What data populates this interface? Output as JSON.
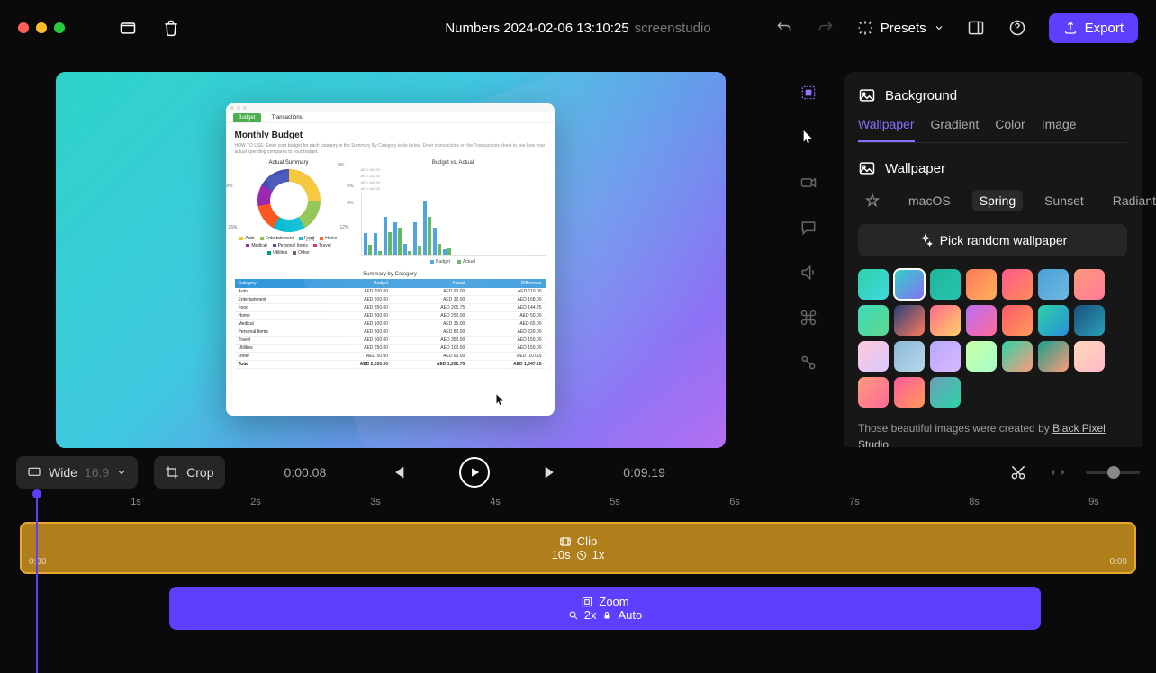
{
  "header": {
    "title": "Numbers 2024-02-06 13:10:25",
    "subtitle": "screenstudio",
    "presets_label": "Presets",
    "export_label": "Export"
  },
  "inspector": {
    "section_title": "Background",
    "tabs": [
      "Wallpaper",
      "Gradient",
      "Color",
      "Image"
    ],
    "sub_title": "Wallpaper",
    "categories": [
      "macOS",
      "Spring",
      "Sunset",
      "Radiant"
    ],
    "pick_label": "Pick random wallpaper",
    "thumbs": [
      "linear-gradient(135deg,#2dd3a8,#3fd8e0)",
      "linear-gradient(135deg,#2dd3c8,#8b6ff5)",
      "linear-gradient(135deg,#1fb59a,#28c4ae)",
      "linear-gradient(135deg,#ff7a5a,#ffb05a)",
      "linear-gradient(135deg,#ff5a8a,#ff8a5a)",
      "linear-gradient(135deg,#4a9fd8,#6fb8e0)",
      "linear-gradient(135deg,#ff9a7a,#ff7a9a)",
      "linear-gradient(135deg,#3dd8b8,#5fd890)",
      "linear-gradient(135deg,#2a3f7a,#ff7a5a)",
      "linear-gradient(135deg,#ff6a8a,#ffcf6a)",
      "linear-gradient(135deg,#b86ff5,#ff6a9a)",
      "linear-gradient(135deg,#ff5a6a,#ff9a5a)",
      "linear-gradient(135deg,#2dd3a8,#2a8fd8)",
      "linear-gradient(135deg,#1a4f7a,#2a9fb8)",
      "linear-gradient(135deg,#ffc8d8,#d8c8ff)",
      "linear-gradient(135deg,#8ab8d8,#b8d8e8)",
      "linear-gradient(135deg,#b8a8ff,#d8b8ff)",
      "linear-gradient(135deg,#c8ffa8,#a8ffc8)",
      "linear-gradient(135deg,#2dd3a8,#ff9a7a)",
      "linear-gradient(135deg,#1a9f8a,#ff9a7a)",
      "linear-gradient(135deg,#ffd8b8,#ffb8c8)",
      "linear-gradient(135deg,#ff9a7a,#ff6a9a)",
      "linear-gradient(135deg,#ff5a9a,#ff9a5a)",
      "linear-gradient(135deg,#6a9fb8,#2dd3a8)"
    ],
    "credit_prefix": "Those beautiful images were created by ",
    "credit_link": "Black Pixel Studio"
  },
  "transport": {
    "wide_label": "Wide",
    "wide_ratio": "16:9",
    "crop_label": "Crop",
    "tc_current": "0:00.08",
    "tc_total": "0:09.19"
  },
  "timeline": {
    "ticks": [
      "1s",
      "2s",
      "3s",
      "4s",
      "5s",
      "6s",
      "7s",
      "8s",
      "9s"
    ],
    "clip_label": "Clip",
    "clip_duration": "10s",
    "clip_speed": "1x",
    "clip_start": "0:00",
    "clip_end": "0:09",
    "zoom_label": "Zoom",
    "zoom_amount": "2x",
    "zoom_mode": "Auto"
  },
  "doc": {
    "tab_active": "Budget",
    "tab_other": "Transactions",
    "h1": "Monthly Budget",
    "howto": "HOW TO USE: Enter your budget for each category in the Summary By Category table below. Enter transactions on the Transactions sheet to see how your actual spending compares to your budget.",
    "donut_title": "Actual Summary",
    "donut_labels": [
      "28%",
      "8%",
      "5%",
      "3%",
      "12%",
      "17%",
      "25%"
    ],
    "donut_side": [
      "AED 100.00",
      "AED 100.00",
      "AED 100.00",
      "AED 100.00"
    ],
    "bars_title": "Budget vs. Actual",
    "legend_items": [
      "Auto",
      "Entertainment",
      "Food",
      "Home",
      "Medical",
      "Personal Items",
      "Travel",
      "Utilities",
      "Other"
    ],
    "bars_legend": [
      "Budget",
      "Actual"
    ],
    "table_title": "Summary by Category",
    "table_headers": [
      "Category",
      "Budget",
      "Actual",
      "Difference"
    ],
    "table_rows": [
      [
        "Auto",
        "AED 200.00",
        "AED 90.00",
        "AED 110.00"
      ],
      [
        "Entertainment",
        "AED 200.00",
        "AED 32.00",
        "AED 168.00"
      ],
      [
        "Food",
        "AED 350.00",
        "AED 205.75",
        "AED 144.25"
      ],
      [
        "Home",
        "AED 300.00",
        "AED 250.00",
        "AED 50.00"
      ],
      [
        "Medical",
        "AED 100.00",
        "AED 35.00",
        "AED 65.00"
      ],
      [
        "Personal Items",
        "AED 300.00",
        "AED 80.00",
        "AED 220.00"
      ],
      [
        "Travel",
        "AED 500.00",
        "AED 350.00",
        "AED 150.00"
      ],
      [
        "Utilities",
        "AED 250.00",
        "AED 100.00",
        "AED 150.00"
      ],
      [
        "Other",
        "AED 50.00",
        "AED 60.00",
        "AED (10.00)"
      ]
    ],
    "table_total": [
      "Total",
      "AED 2,250.00",
      "AED 1,202.75",
      "AED 1,047.25"
    ]
  },
  "chart_data": [
    {
      "type": "pie",
      "title": "Actual Summary",
      "categories": [
        "Auto",
        "Entertainment",
        "Food",
        "Home",
        "Medical",
        "Personal Items",
        "Travel",
        "Utilities",
        "Other"
      ],
      "values": [
        28,
        8,
        5,
        3,
        12,
        17,
        25,
        1,
        1
      ],
      "unit": "%"
    },
    {
      "type": "bar",
      "title": "Budget vs. Actual",
      "categories": [
        "Auto",
        "Entertainment",
        "Food",
        "Home",
        "Medical",
        "Personal Items",
        "Travel",
        "Utilities",
        "Other"
      ],
      "series": [
        {
          "name": "Budget",
          "values": [
            200,
            200,
            350,
            300,
            100,
            300,
            500,
            250,
            50
          ]
        },
        {
          "name": "Actual",
          "values": [
            90,
            32,
            205.75,
            250,
            35,
            80,
            350,
            100,
            60
          ]
        }
      ],
      "ylabel": "AED",
      "ylim": [
        0,
        500
      ]
    },
    {
      "type": "table",
      "title": "Summary by Category",
      "columns": [
        "Category",
        "Budget",
        "Actual",
        "Difference"
      ],
      "rows": [
        [
          "Auto",
          200,
          90,
          110
        ],
        [
          "Entertainment",
          200,
          32,
          168
        ],
        [
          "Food",
          350,
          205.75,
          144.25
        ],
        [
          "Home",
          300,
          250,
          50
        ],
        [
          "Medical",
          100,
          35,
          65
        ],
        [
          "Personal Items",
          300,
          80,
          220
        ],
        [
          "Travel",
          500,
          350,
          150
        ],
        [
          "Utilities",
          250,
          100,
          150
        ],
        [
          "Other",
          50,
          60,
          -10
        ],
        [
          "Total",
          2250,
          1202.75,
          1047.25
        ]
      ],
      "unit": "AED"
    }
  ]
}
